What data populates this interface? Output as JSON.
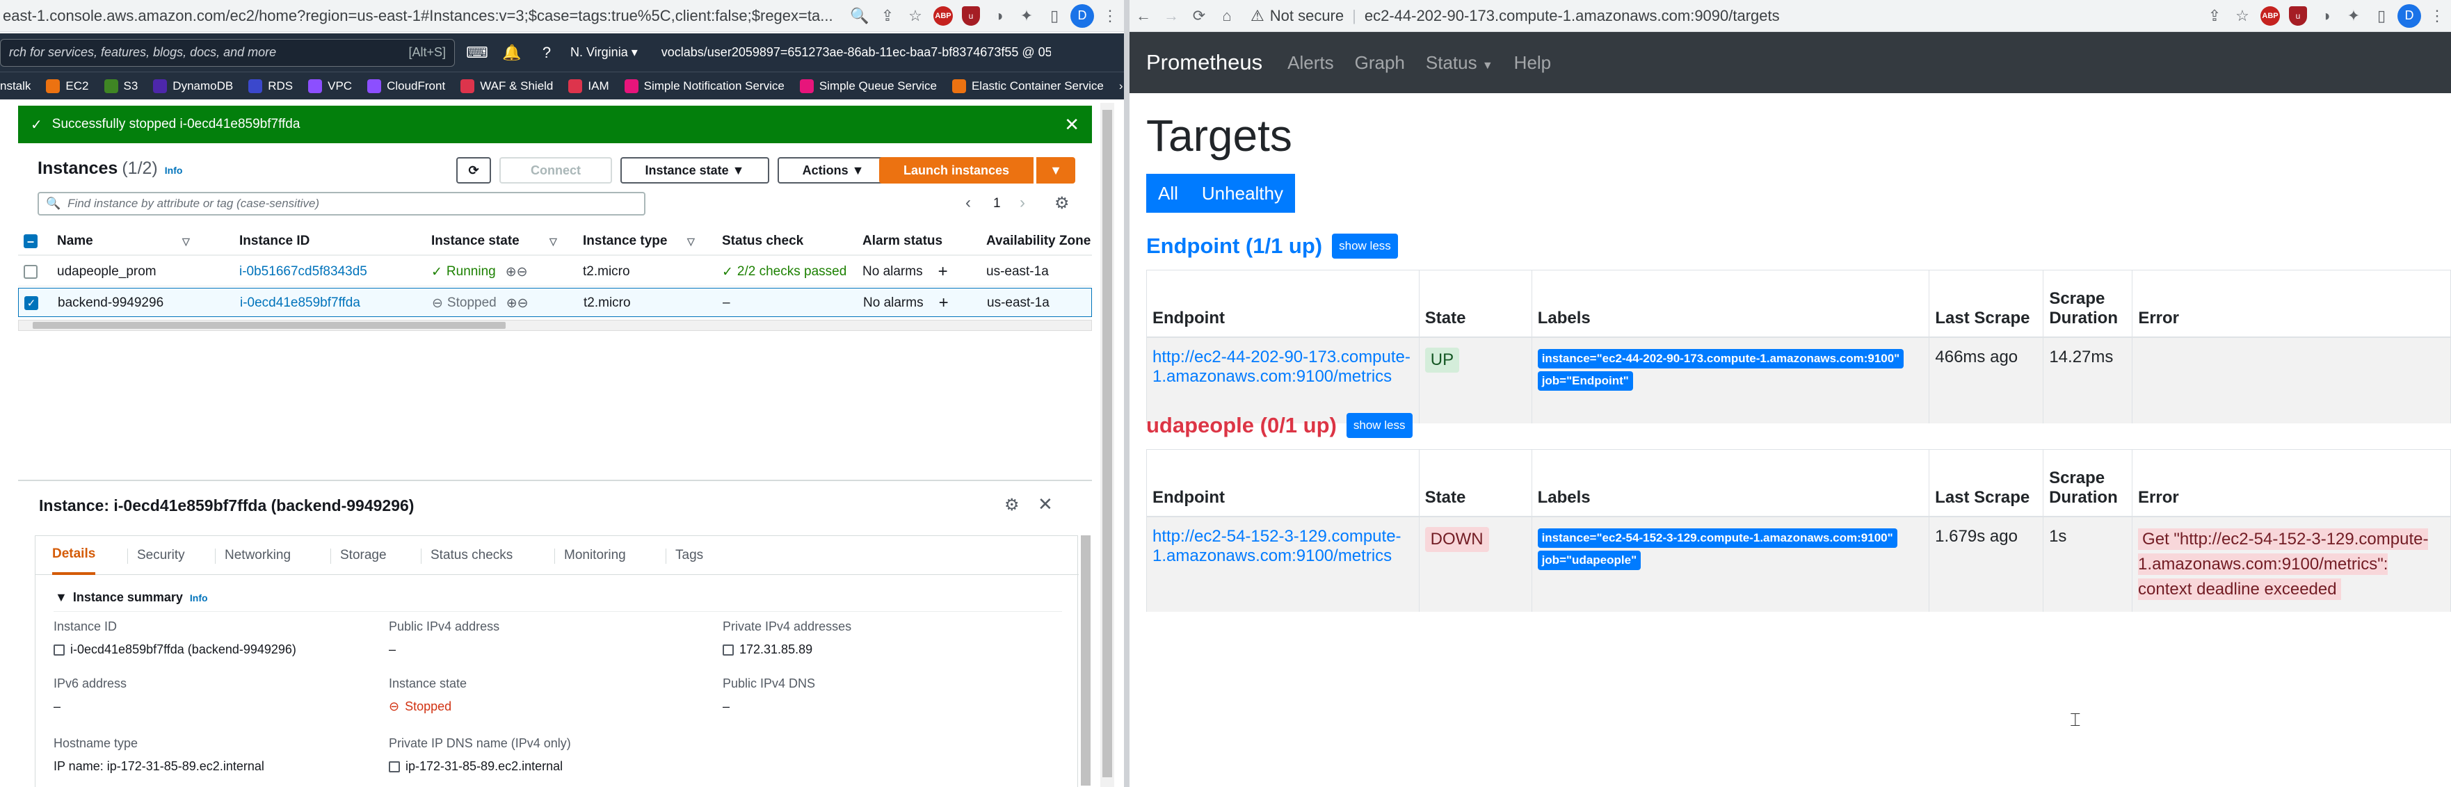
{
  "left_browser": {
    "url": "east-1.console.aws.amazon.com/ec2/home?region=us-east-1#Instances:v=3;$case=tags:true%5C,client:false;$regex=ta...",
    "aws": {
      "search_placeholder": "rch for services, features, blogs, docs, and more",
      "search_shortcut": "[Alt+S]",
      "region": "N. Virginia",
      "account": "voclabs/user2059897=651273ae-86ab-11ec-baa7-bf8374673f55 @ 05...",
      "favorites": [
        "nstalk",
        "EC2",
        "S3",
        "DynamoDB",
        "RDS",
        "VPC",
        "CloudFront",
        "WAF & Shield",
        "IAM",
        "Simple Notification Service",
        "Simple Queue Service",
        "Elastic Container Service"
      ],
      "favorite_colors": [
        "#ec7211",
        "#ec7211",
        "#3f8624",
        "#4d27aa",
        "#3b48cc",
        "#8c4fff",
        "#8c4fff",
        "#dd344c",
        "#dd344c",
        "#e7157b",
        "#e7157b",
        "#ec7211"
      ]
    },
    "flash": {
      "message": "Successfully stopped i-0ecd41e859bf7ffda"
    },
    "instances": {
      "title": "Instances",
      "count": "(1/2)",
      "info": "Info",
      "buttons": {
        "connect": "Connect",
        "instance_state": "Instance state",
        "actions": "Actions",
        "launch": "Launch instances"
      },
      "filter_placeholder": "Find instance by attribute or tag (case-sensitive)",
      "page": "1",
      "columns": [
        "Name",
        "Instance ID",
        "Instance state",
        "Instance type",
        "Status check",
        "Alarm status",
        "Availability Zone"
      ],
      "rows": [
        {
          "name": "udapeople_prom",
          "id": "i-0b51667cd5f8343d5",
          "state": "Running",
          "type": "t2.micro",
          "status": "2/2 checks passed",
          "alarm": "No alarms",
          "az": "us-east-1a"
        },
        {
          "name": "backend-9949296",
          "id": "i-0ecd41e859bf7ffda",
          "state": "Stopped",
          "type": "t2.micro",
          "status": "–",
          "alarm": "No alarms",
          "az": "us-east-1a"
        }
      ]
    },
    "details": {
      "title": "Instance: i-0ecd41e859bf7ffda (backend-9949296)",
      "tabs": [
        "Details",
        "Security",
        "Networking",
        "Storage",
        "Status checks",
        "Monitoring",
        "Tags"
      ],
      "summary_title": "Instance summary",
      "summary_info": "Info",
      "fields": {
        "instance_id_k": "Instance ID",
        "instance_id_v": "i-0ecd41e859bf7ffda (backend-9949296)",
        "public_ipv4_k": "Public IPv4 address",
        "public_ipv4_v": "–",
        "private_ipv4_k": "Private IPv4 addresses",
        "private_ipv4_v": "172.31.85.89",
        "ipv6_k": "IPv6 address",
        "ipv6_v": "–",
        "state_k": "Instance state",
        "state_v": "Stopped",
        "public_dns_k": "Public IPv4 DNS",
        "public_dns_v": "–",
        "hostname_k": "Hostname type",
        "hostname_v": "IP name: ip-172-31-85-89.ec2.internal",
        "private_dns_k": "Private IP DNS name (IPv4 only)",
        "private_dns_v": "ip-172-31-85-89.ec2.internal"
      }
    }
  },
  "right_browser": {
    "not_secure": "Not secure",
    "url": "ec2-44-202-90-173.compute-1.amazonaws.com:9090/targets",
    "nav": {
      "brand": "Prometheus",
      "items": [
        "Alerts",
        "Graph",
        "Status",
        "Help"
      ]
    },
    "page_title": "Targets",
    "filter": {
      "all": "All",
      "unhealthy": "Unhealthy"
    },
    "columns": [
      "Endpoint",
      "State",
      "Labels",
      "Last Scrape",
      "Scrape Duration",
      "Error"
    ],
    "show_less": "show less",
    "pools": [
      {
        "title": "Endpoint (1/1 up)",
        "color": "#007bff",
        "target": {
          "endpoint": "http://ec2-44-202-90-173.compute-1.amazonaws.com:9100/metrics",
          "state": "UP",
          "labels": [
            "instance=\"ec2-44-202-90-173.compute-1.amazonaws.com:9100\"",
            "job=\"Endpoint\""
          ],
          "last_scrape": "466ms ago",
          "duration": "14.27ms",
          "error": ""
        }
      },
      {
        "title": "udapeople (0/1 up)",
        "color": "#dc3545",
        "target": {
          "endpoint": "http://ec2-54-152-3-129.compute-1.amazonaws.com:9100/metrics",
          "state": "DOWN",
          "labels": [
            "instance=\"ec2-54-152-3-129.compute-1.amazonaws.com:9100\"",
            "job=\"udapeople\""
          ],
          "last_scrape": "1.679s ago",
          "duration": "1s",
          "error": "Get \"http://ec2-54-152-3-129.compute-1.amazonaws.com:9100/metrics\": context deadline exceeded"
        }
      }
    ]
  }
}
